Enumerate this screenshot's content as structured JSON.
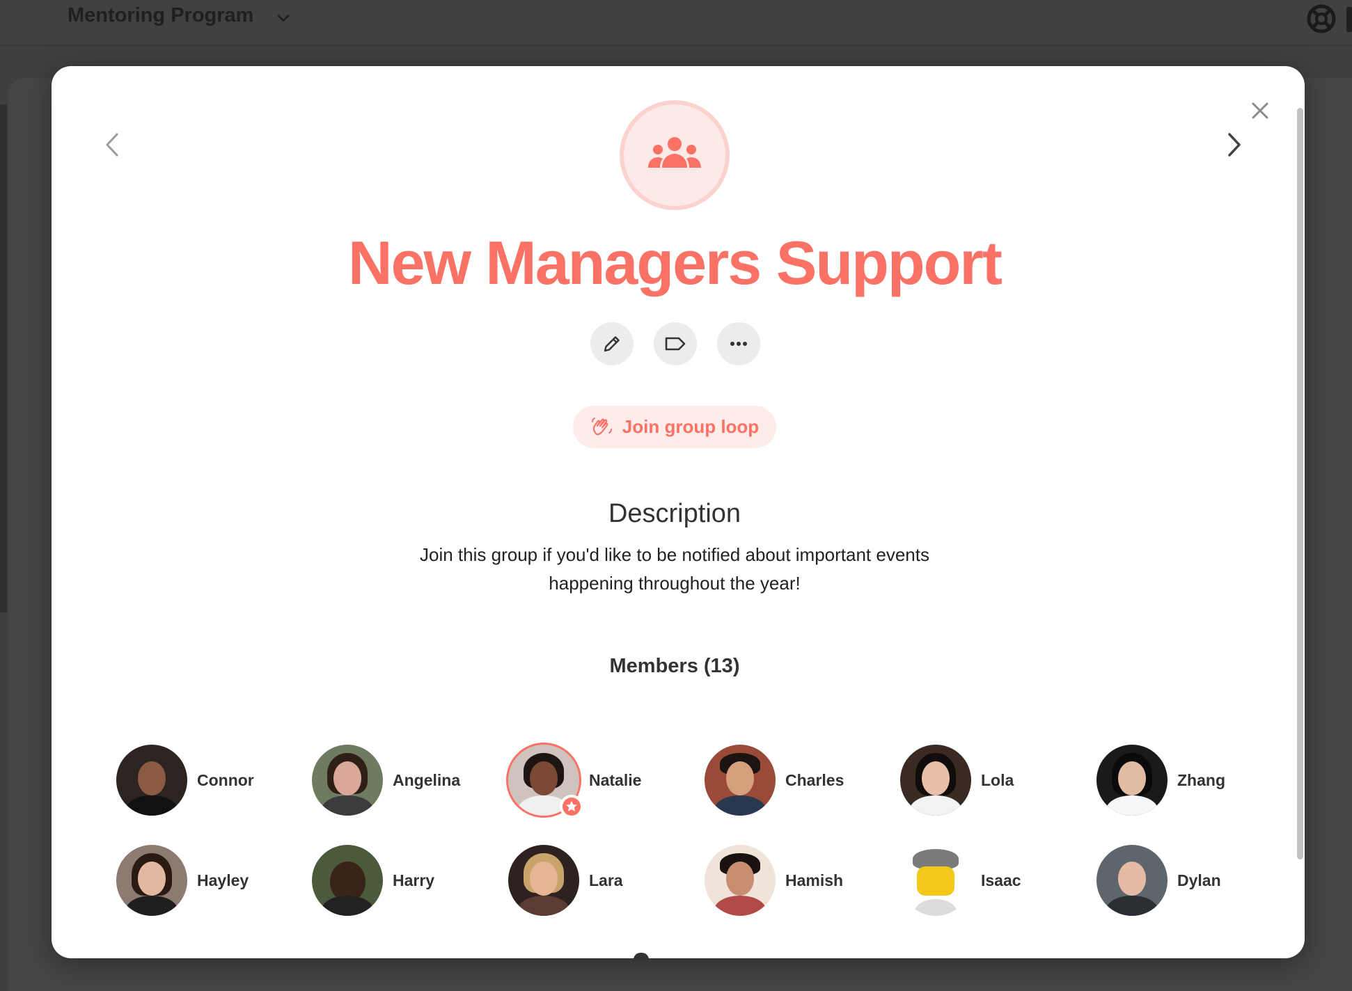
{
  "topbar": {
    "program_title": "Mentoring Program",
    "dropdown_icon": "chevron-down-icon",
    "help_icon": "lifebuoy-icon"
  },
  "modal": {
    "group_icon": "users-group-icon",
    "title": "New Managers Support",
    "actions": [
      {
        "name": "edit",
        "icon": "pencil-icon"
      },
      {
        "name": "tag",
        "icon": "tag-icon"
      },
      {
        "name": "more",
        "icon": "more-dots-icon"
      }
    ],
    "join_button": {
      "label": "Join group loop",
      "icon": "wave-hand-icon"
    },
    "description_heading": "Description",
    "description_text": "Join this group if you'd like to be notified about important events happening throughout the year!",
    "members_heading": "Members (13)",
    "members": [
      {
        "name": "Connor"
      },
      {
        "name": "Angelina"
      },
      {
        "name": "Natalie",
        "badge": "star-icon"
      },
      {
        "name": "Charles"
      },
      {
        "name": "Lola"
      },
      {
        "name": "Zhang"
      },
      {
        "name": "Hayley"
      },
      {
        "name": "Harry"
      },
      {
        "name": "Lara"
      },
      {
        "name": "Hamish"
      },
      {
        "name": "Isaac"
      },
      {
        "name": "Dylan"
      }
    ]
  },
  "colors": {
    "accent": "#fa7266",
    "accent_light": "#fdecea",
    "overlay": "#3f3f3f"
  }
}
